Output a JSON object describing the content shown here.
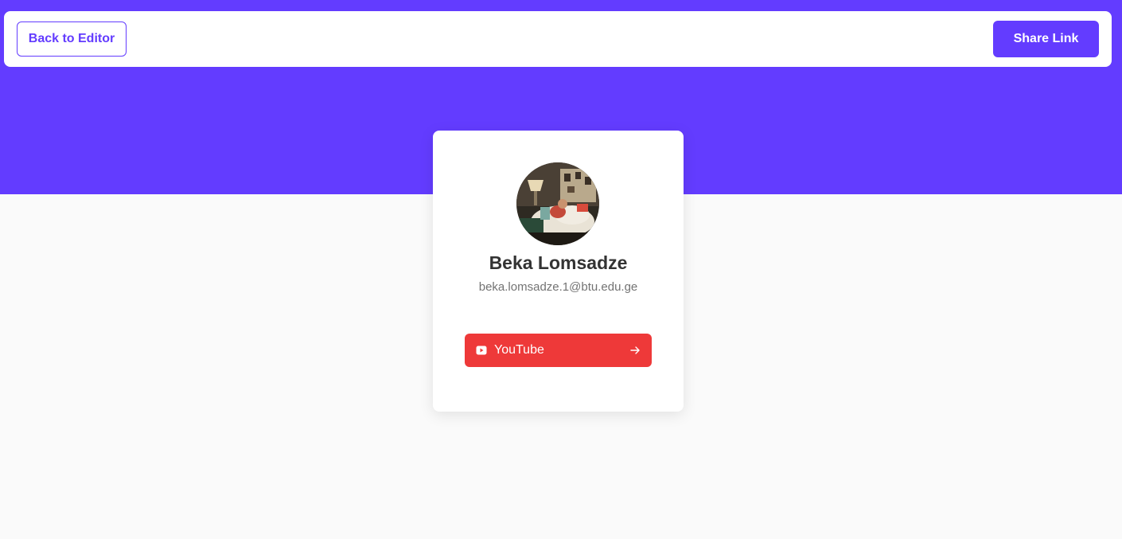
{
  "toolbar": {
    "back_label": "Back to Editor",
    "share_label": "Share Link"
  },
  "profile": {
    "name": "Beka Lomsadze",
    "email": "beka.lomsadze.1@btu.edu.ge",
    "avatar_icon": "profile-photo"
  },
  "links": [
    {
      "platform": "YouTube",
      "icon": "youtube-icon",
      "color": "#ee3939"
    }
  ],
  "colors": {
    "brand": "#633cff",
    "background": "#fafafa",
    "card": "#ffffff",
    "youtube": "#ee3939"
  }
}
